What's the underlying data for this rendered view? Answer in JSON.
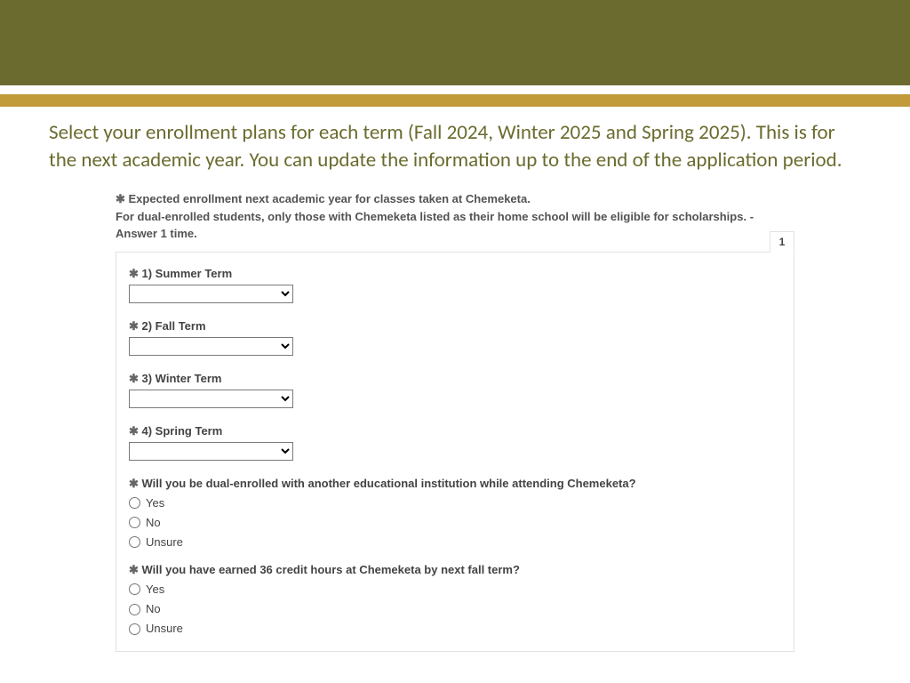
{
  "intro": "Select your enrollment plans for each term (Fall 2024, Winter 2025 and Spring 2025).  This is for the next academic year. You can update the information up to the end of the application period.",
  "form": {
    "heading_line1": "Expected enrollment next academic year for classes taken at Chemeketa.",
    "heading_line2": "For dual-enrolled students, only those with Chemeketa listed as their home school will be eligible for scholarships. - Answer 1 time.",
    "tab": "1",
    "terms": {
      "summer": "1) Summer Term",
      "fall": "2) Fall Term",
      "winter": "3) Winter Term",
      "spring": "4) Spring Term"
    },
    "dual_question": "Will you be dual-enrolled with another educational institution while attending Chemeketa?",
    "credits_question": "Will you have earned 36 credit hours at Chemeketa by next fall term?",
    "options": {
      "yes": "Yes",
      "no": "No",
      "unsure": "Unsure"
    }
  }
}
